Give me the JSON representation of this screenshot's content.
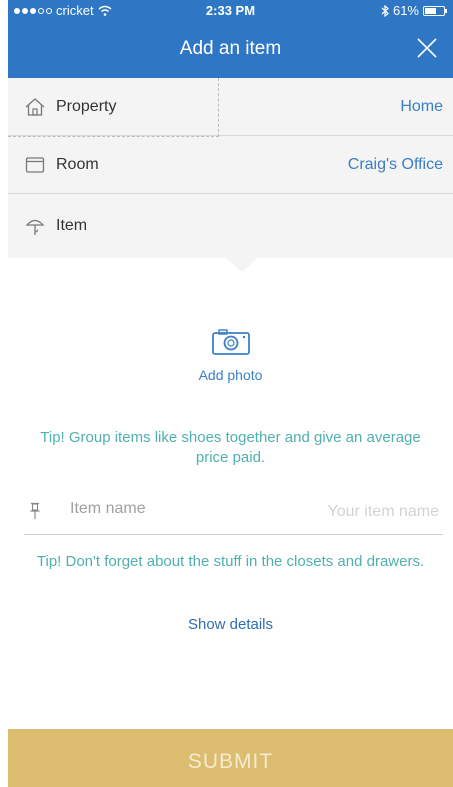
{
  "status_bar": {
    "carrier": "cricket",
    "time": "2:33 PM",
    "battery": "61%",
    "battery_level": 0.61
  },
  "header": {
    "title": "Add an item"
  },
  "rows": [
    {
      "label": "Property",
      "value": "Home",
      "icon": "house-icon"
    },
    {
      "label": "Room",
      "value": "Craig's Office",
      "icon": "window-icon"
    },
    {
      "label": "Item",
      "value": "",
      "icon": "lamp-icon"
    }
  ],
  "photo": {
    "label": "Add photo"
  },
  "tips": {
    "tip1": "Tip! Group items like shoes together and give an average price paid.",
    "tip2": "Tip! Don't forget about the stuff in the closets and drawers."
  },
  "item_field": {
    "label": "Item name",
    "placeholder": "Your item name",
    "value": ""
  },
  "show_details": "Show details",
  "submit": "SUBMIT",
  "colors": {
    "nav": "#2f77c4",
    "accent": "#3b7fc6",
    "tip": "#4fb0ad",
    "submit": "#dcbc6f"
  }
}
